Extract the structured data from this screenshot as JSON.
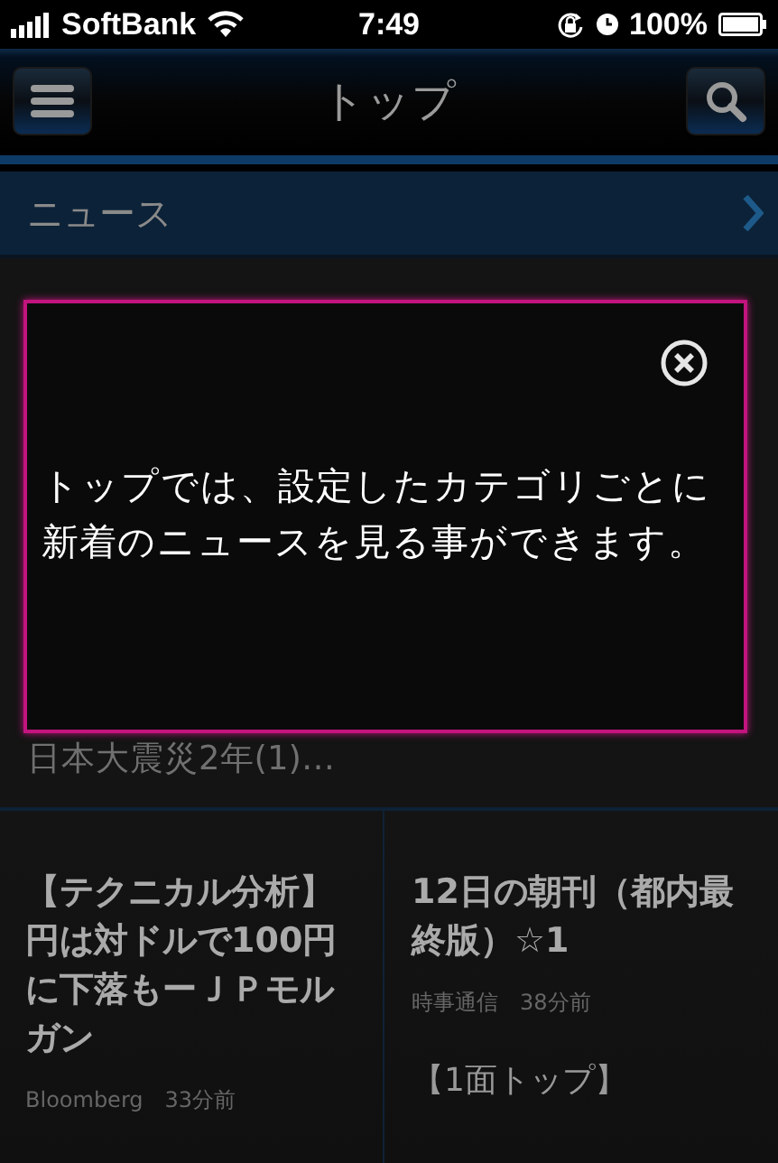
{
  "status_bar": {
    "carrier": "SoftBank",
    "time": "7:49",
    "battery": "100%"
  },
  "nav": {
    "title": "トップ"
  },
  "section": {
    "title": "ニュース"
  },
  "featured": {
    "visible_text": "日本大震災2年(1)…"
  },
  "articles": [
    {
      "headline": "【テクニカル分析】円は対ドルで100円に下落もーＪＰモルガン",
      "source": "Bloomberg　33分前"
    },
    {
      "headline": "12日の朝刊（都内最終版）☆1",
      "source": "時事通信　38分前",
      "lead": "【1面トップ】"
    }
  ],
  "tip": {
    "message": "トップでは、設定したカテゴリごとに新着のニュースを見る事ができます。"
  }
}
